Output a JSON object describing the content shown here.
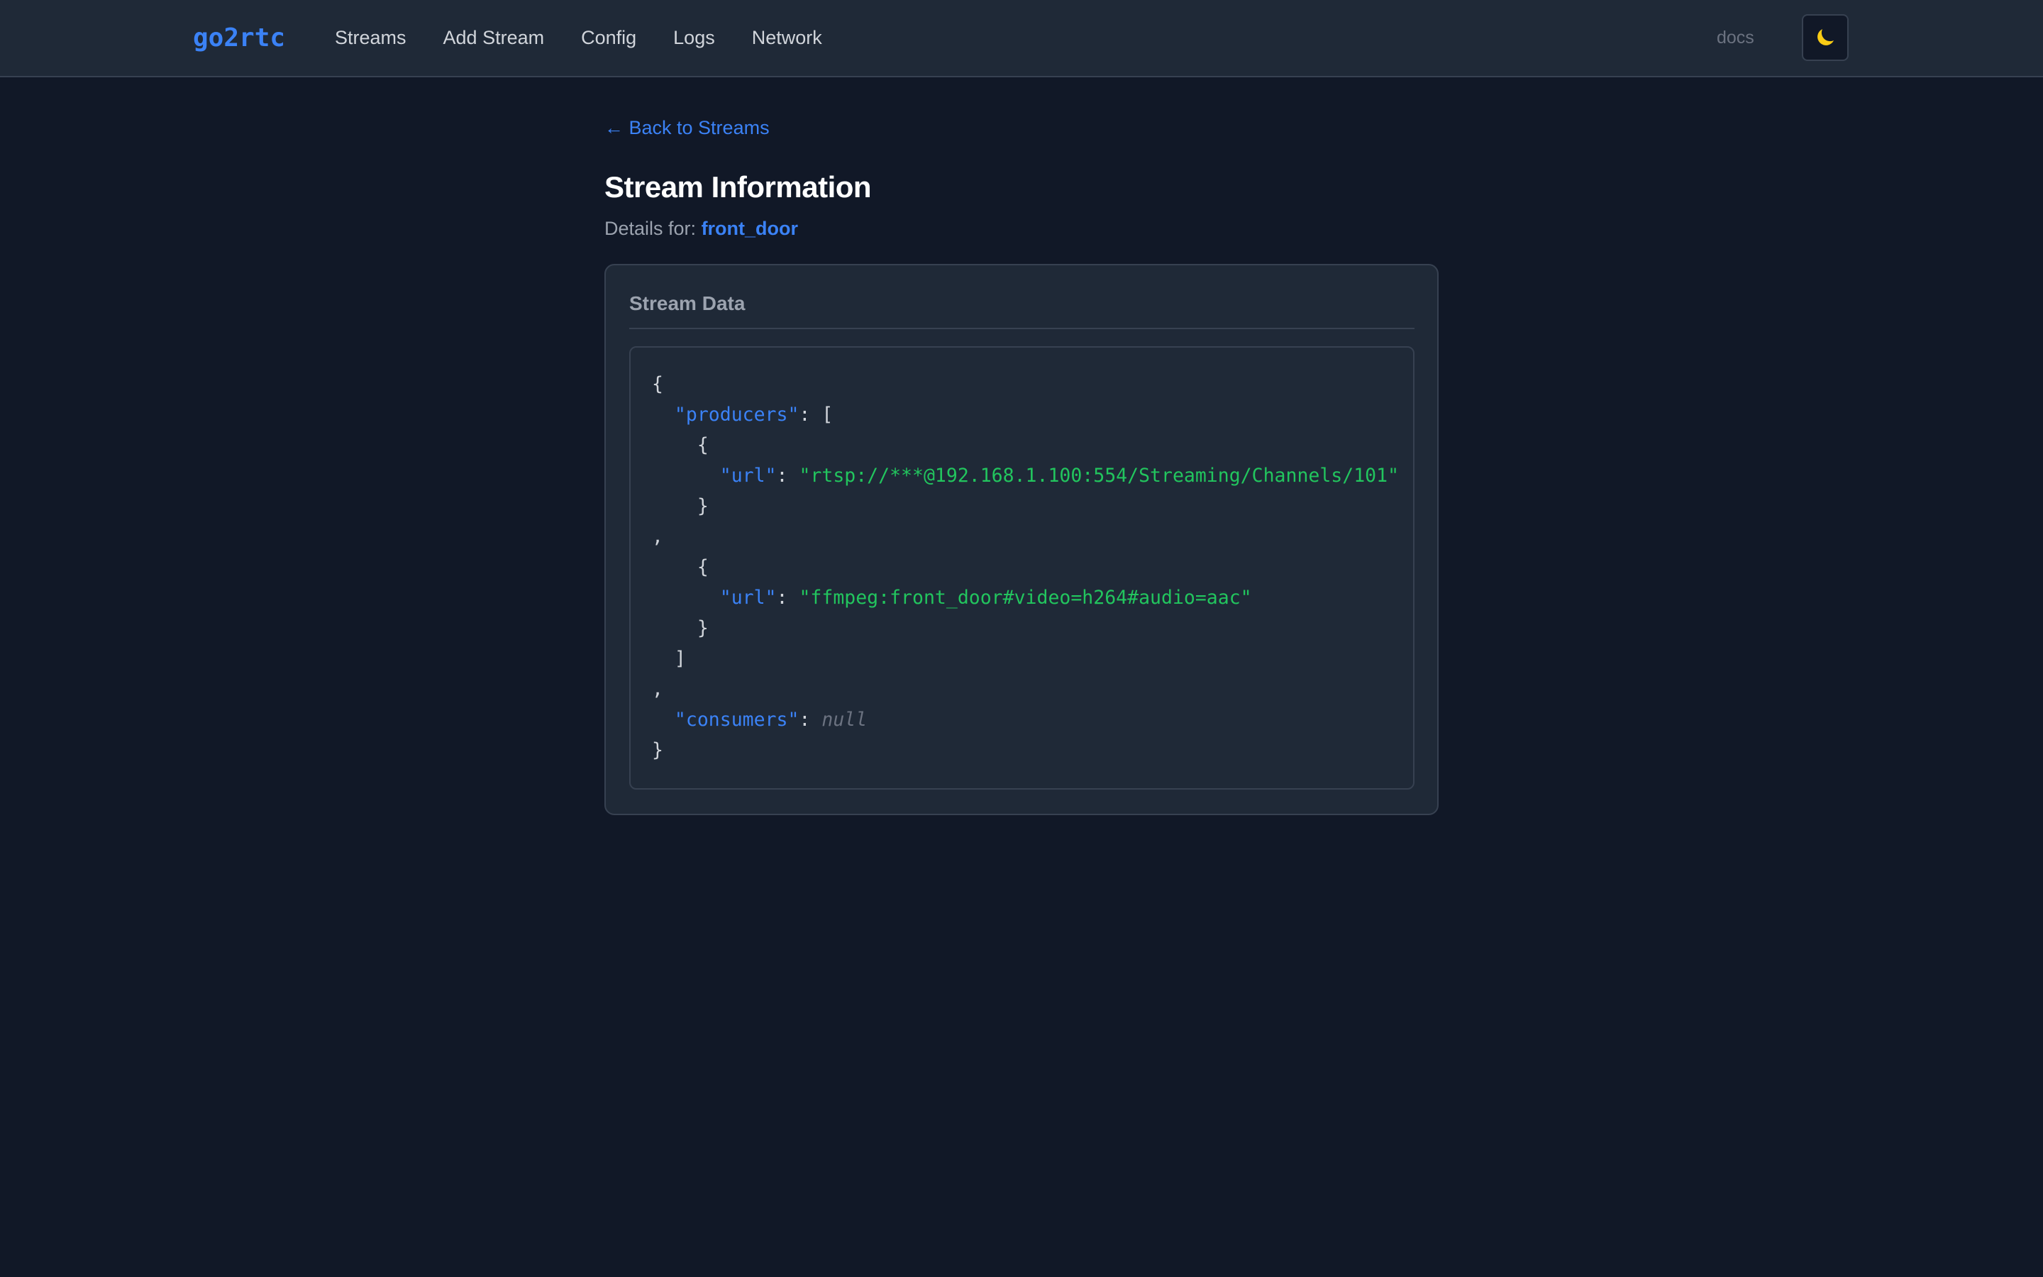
{
  "header": {
    "brand": "go2rtc",
    "nav": [
      "Streams",
      "Add Stream",
      "Config",
      "Logs",
      "Network"
    ],
    "docs_label": "docs",
    "theme_toggle_icon": "moon-icon"
  },
  "main": {
    "back_label": "← Back to Streams",
    "title": "Stream Information",
    "details_prefix": "Details for:",
    "stream_name": "front_door",
    "card_title": "Stream Data",
    "json": {
      "open_brace": "{",
      "producers_key": "\"producers\"",
      "colon": ":",
      "open_bracket": "[",
      "item_open": "{",
      "url_key": "\"url\"",
      "producer_1_url": "\"rtsp://***@192.168.1.100:554/Streaming/Channels/101\"",
      "item_close": "}",
      "comma": ",",
      "producer_2_url": "\"ffmpeg:front_door#video=h264#audio=aac\"",
      "close_bracket": "]",
      "consumers_key": "\"consumers\"",
      "consumers_value": "null",
      "close_brace": "}"
    }
  },
  "colors": {
    "background": "#111827",
    "navbar": "#1f2937",
    "accent": "#3b82f6",
    "string": "#22c55e",
    "muted": "#9ca3af"
  }
}
